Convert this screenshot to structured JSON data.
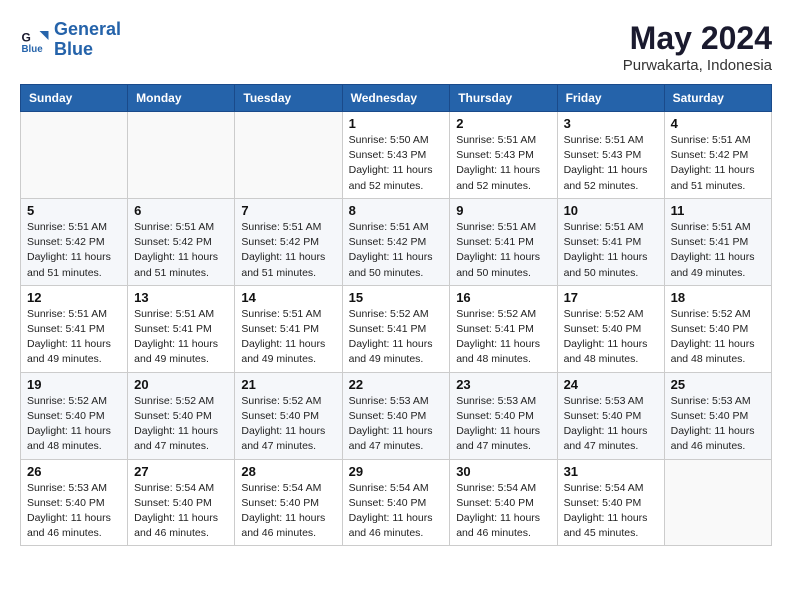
{
  "logo": {
    "line1": "General",
    "line2": "Blue"
  },
  "title": "May 2024",
  "location": "Purwakarta, Indonesia",
  "days_header": [
    "Sunday",
    "Monday",
    "Tuesday",
    "Wednesday",
    "Thursday",
    "Friday",
    "Saturday"
  ],
  "weeks": [
    [
      {
        "day": "",
        "info": ""
      },
      {
        "day": "",
        "info": ""
      },
      {
        "day": "",
        "info": ""
      },
      {
        "day": "1",
        "info": "Sunrise: 5:50 AM\nSunset: 5:43 PM\nDaylight: 11 hours and 52 minutes."
      },
      {
        "day": "2",
        "info": "Sunrise: 5:51 AM\nSunset: 5:43 PM\nDaylight: 11 hours and 52 minutes."
      },
      {
        "day": "3",
        "info": "Sunrise: 5:51 AM\nSunset: 5:43 PM\nDaylight: 11 hours and 52 minutes."
      },
      {
        "day": "4",
        "info": "Sunrise: 5:51 AM\nSunset: 5:42 PM\nDaylight: 11 hours and 51 minutes."
      }
    ],
    [
      {
        "day": "5",
        "info": "Sunrise: 5:51 AM\nSunset: 5:42 PM\nDaylight: 11 hours and 51 minutes."
      },
      {
        "day": "6",
        "info": "Sunrise: 5:51 AM\nSunset: 5:42 PM\nDaylight: 11 hours and 51 minutes."
      },
      {
        "day": "7",
        "info": "Sunrise: 5:51 AM\nSunset: 5:42 PM\nDaylight: 11 hours and 51 minutes."
      },
      {
        "day": "8",
        "info": "Sunrise: 5:51 AM\nSunset: 5:42 PM\nDaylight: 11 hours and 50 minutes."
      },
      {
        "day": "9",
        "info": "Sunrise: 5:51 AM\nSunset: 5:41 PM\nDaylight: 11 hours and 50 minutes."
      },
      {
        "day": "10",
        "info": "Sunrise: 5:51 AM\nSunset: 5:41 PM\nDaylight: 11 hours and 50 minutes."
      },
      {
        "day": "11",
        "info": "Sunrise: 5:51 AM\nSunset: 5:41 PM\nDaylight: 11 hours and 49 minutes."
      }
    ],
    [
      {
        "day": "12",
        "info": "Sunrise: 5:51 AM\nSunset: 5:41 PM\nDaylight: 11 hours and 49 minutes."
      },
      {
        "day": "13",
        "info": "Sunrise: 5:51 AM\nSunset: 5:41 PM\nDaylight: 11 hours and 49 minutes."
      },
      {
        "day": "14",
        "info": "Sunrise: 5:51 AM\nSunset: 5:41 PM\nDaylight: 11 hours and 49 minutes."
      },
      {
        "day": "15",
        "info": "Sunrise: 5:52 AM\nSunset: 5:41 PM\nDaylight: 11 hours and 49 minutes."
      },
      {
        "day": "16",
        "info": "Sunrise: 5:52 AM\nSunset: 5:41 PM\nDaylight: 11 hours and 48 minutes."
      },
      {
        "day": "17",
        "info": "Sunrise: 5:52 AM\nSunset: 5:40 PM\nDaylight: 11 hours and 48 minutes."
      },
      {
        "day": "18",
        "info": "Sunrise: 5:52 AM\nSunset: 5:40 PM\nDaylight: 11 hours and 48 minutes."
      }
    ],
    [
      {
        "day": "19",
        "info": "Sunrise: 5:52 AM\nSunset: 5:40 PM\nDaylight: 11 hours and 48 minutes."
      },
      {
        "day": "20",
        "info": "Sunrise: 5:52 AM\nSunset: 5:40 PM\nDaylight: 11 hours and 47 minutes."
      },
      {
        "day": "21",
        "info": "Sunrise: 5:52 AM\nSunset: 5:40 PM\nDaylight: 11 hours and 47 minutes."
      },
      {
        "day": "22",
        "info": "Sunrise: 5:53 AM\nSunset: 5:40 PM\nDaylight: 11 hours and 47 minutes."
      },
      {
        "day": "23",
        "info": "Sunrise: 5:53 AM\nSunset: 5:40 PM\nDaylight: 11 hours and 47 minutes."
      },
      {
        "day": "24",
        "info": "Sunrise: 5:53 AM\nSunset: 5:40 PM\nDaylight: 11 hours and 47 minutes."
      },
      {
        "day": "25",
        "info": "Sunrise: 5:53 AM\nSunset: 5:40 PM\nDaylight: 11 hours and 46 minutes."
      }
    ],
    [
      {
        "day": "26",
        "info": "Sunrise: 5:53 AM\nSunset: 5:40 PM\nDaylight: 11 hours and 46 minutes."
      },
      {
        "day": "27",
        "info": "Sunrise: 5:54 AM\nSunset: 5:40 PM\nDaylight: 11 hours and 46 minutes."
      },
      {
        "day": "28",
        "info": "Sunrise: 5:54 AM\nSunset: 5:40 PM\nDaylight: 11 hours and 46 minutes."
      },
      {
        "day": "29",
        "info": "Sunrise: 5:54 AM\nSunset: 5:40 PM\nDaylight: 11 hours and 46 minutes."
      },
      {
        "day": "30",
        "info": "Sunrise: 5:54 AM\nSunset: 5:40 PM\nDaylight: 11 hours and 46 minutes."
      },
      {
        "day": "31",
        "info": "Sunrise: 5:54 AM\nSunset: 5:40 PM\nDaylight: 11 hours and 45 minutes."
      },
      {
        "day": "",
        "info": ""
      }
    ]
  ]
}
